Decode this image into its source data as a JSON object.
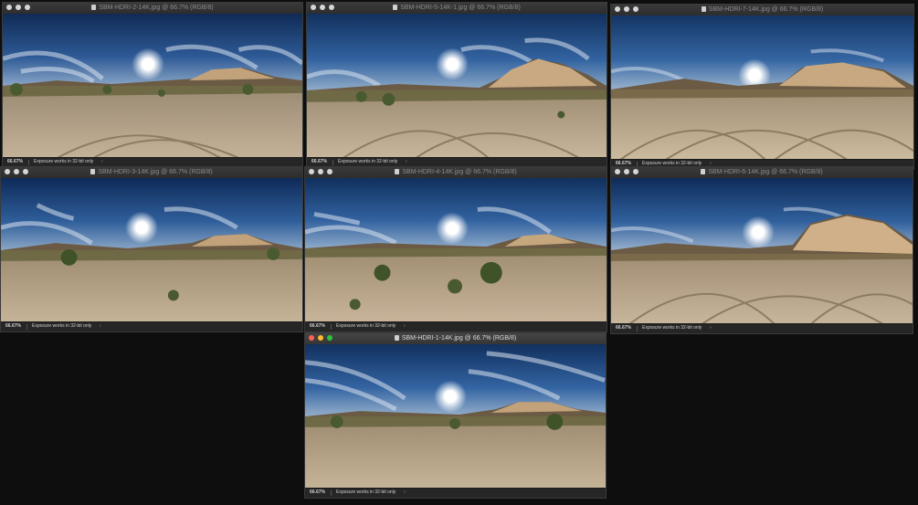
{
  "windows": [
    {
      "id": "w2",
      "title": "SBM-HDRI-2-14K.jpg @ 66.7% (RGB/8)",
      "zoom": "66.67%",
      "status": "Exposure works in 32-bit only"
    },
    {
      "id": "w5",
      "title": "SBM-HDRI-5-14K-1.jpg @ 66.7% (RGB/8)",
      "zoom": "66.67%",
      "status": "Exposure works in 32-bit only"
    },
    {
      "id": "w7",
      "title": "SBM-HDRI-7-14K.jpg @ 66.7% (RGB/8)",
      "zoom": "66.67%",
      "status": "Exposure works in 32-bit only"
    },
    {
      "id": "w3",
      "title": "SBM-HDRI-3-14K.jpg @ 66.7% (RGB/8)",
      "zoom": "66.67%",
      "status": "Exposure works in 32-bit only"
    },
    {
      "id": "w4",
      "title": "SBM-HDRI-4-14K.jpg @ 66.7% (RGB/8)",
      "zoom": "66.67%",
      "status": "Exposure works in 32-bit only"
    },
    {
      "id": "w6",
      "title": "SBM-HDRI-6-14K.jpg @ 66.7% (RGB/8)",
      "zoom": "66.67%",
      "status": "Exposure works in 32-bit only"
    },
    {
      "id": "w1",
      "title": "SBM-HDRI-1-14K.jpg @ 66.7% (RGB/8)",
      "zoom": "66.67%",
      "status": "Exposure works in 32-bit only"
    }
  ],
  "icons": {
    "window_controls": "traffic-light-icons",
    "document": "document-icon",
    "status_arrow": "chevron-right-icon"
  },
  "colors": {
    "close": "#ff5f57",
    "minimize": "#febc2e",
    "zoom": "#28c840",
    "inactive_light": "#d6d6d6"
  }
}
